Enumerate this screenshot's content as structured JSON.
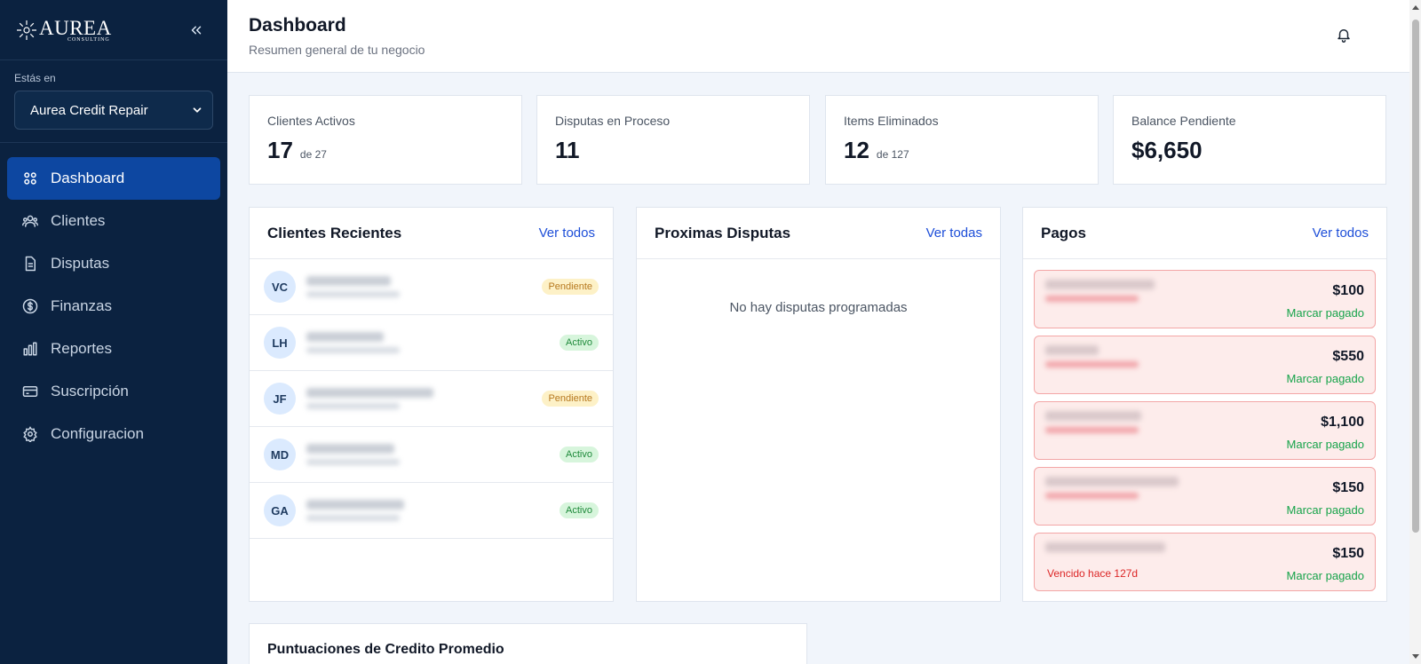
{
  "sidebar": {
    "brand_name": "AUREA",
    "brand_sub": "CONSULTING",
    "context_label": "Estás en",
    "context_value": "Aurea Credit Repair",
    "items": [
      {
        "label": "Dashboard",
        "icon": "grid-icon"
      },
      {
        "label": "Clientes",
        "icon": "users-icon"
      },
      {
        "label": "Disputas",
        "icon": "document-icon"
      },
      {
        "label": "Finanzas",
        "icon": "dollar-icon"
      },
      {
        "label": "Reportes",
        "icon": "bar-chart-icon"
      },
      {
        "label": "Suscripción",
        "icon": "card-icon"
      },
      {
        "label": "Configuracion",
        "icon": "gear-icon"
      }
    ]
  },
  "header": {
    "title": "Dashboard",
    "subtitle": "Resumen general de tu negocio"
  },
  "stats": [
    {
      "label": "Clientes Activos",
      "value": "17",
      "sub": "de 27"
    },
    {
      "label": "Disputas en Proceso",
      "value": "11",
      "sub": ""
    },
    {
      "label": "Items Eliminados",
      "value": "12",
      "sub": "de 127"
    },
    {
      "label": "Balance Pendiente",
      "value": "$6,650",
      "sub": ""
    }
  ],
  "recent_clients": {
    "title": "Clientes Recientes",
    "link": "Ver todos",
    "rows": [
      {
        "initials": "VC",
        "status": "Pendiente"
      },
      {
        "initials": "LH",
        "status": "Activo"
      },
      {
        "initials": "JF",
        "status": "Pendiente"
      },
      {
        "initials": "MD",
        "status": "Activo"
      },
      {
        "initials": "GA",
        "status": "Activo"
      }
    ]
  },
  "upcoming_disputes": {
    "title": "Proximas Disputas",
    "link": "Ver todas",
    "empty": "No hay disputas programadas"
  },
  "payments": {
    "title": "Pagos",
    "link": "Ver todos",
    "mark_label": "Marcar pagado",
    "last_due": "Vencido hace 127d",
    "items": [
      {
        "amount": "$100"
      },
      {
        "amount": "$550"
      },
      {
        "amount": "$1,100"
      },
      {
        "amount": "$150"
      },
      {
        "amount": "$150"
      }
    ]
  },
  "credit_scores": {
    "title": "Puntuaciones de Credito Promedio"
  },
  "colors": {
    "sidebar_bg": "#0b2240",
    "active_nav": "#0d47a1",
    "link": "#1d4ed8",
    "success": "#16a34a",
    "danger": "#dc2626"
  }
}
